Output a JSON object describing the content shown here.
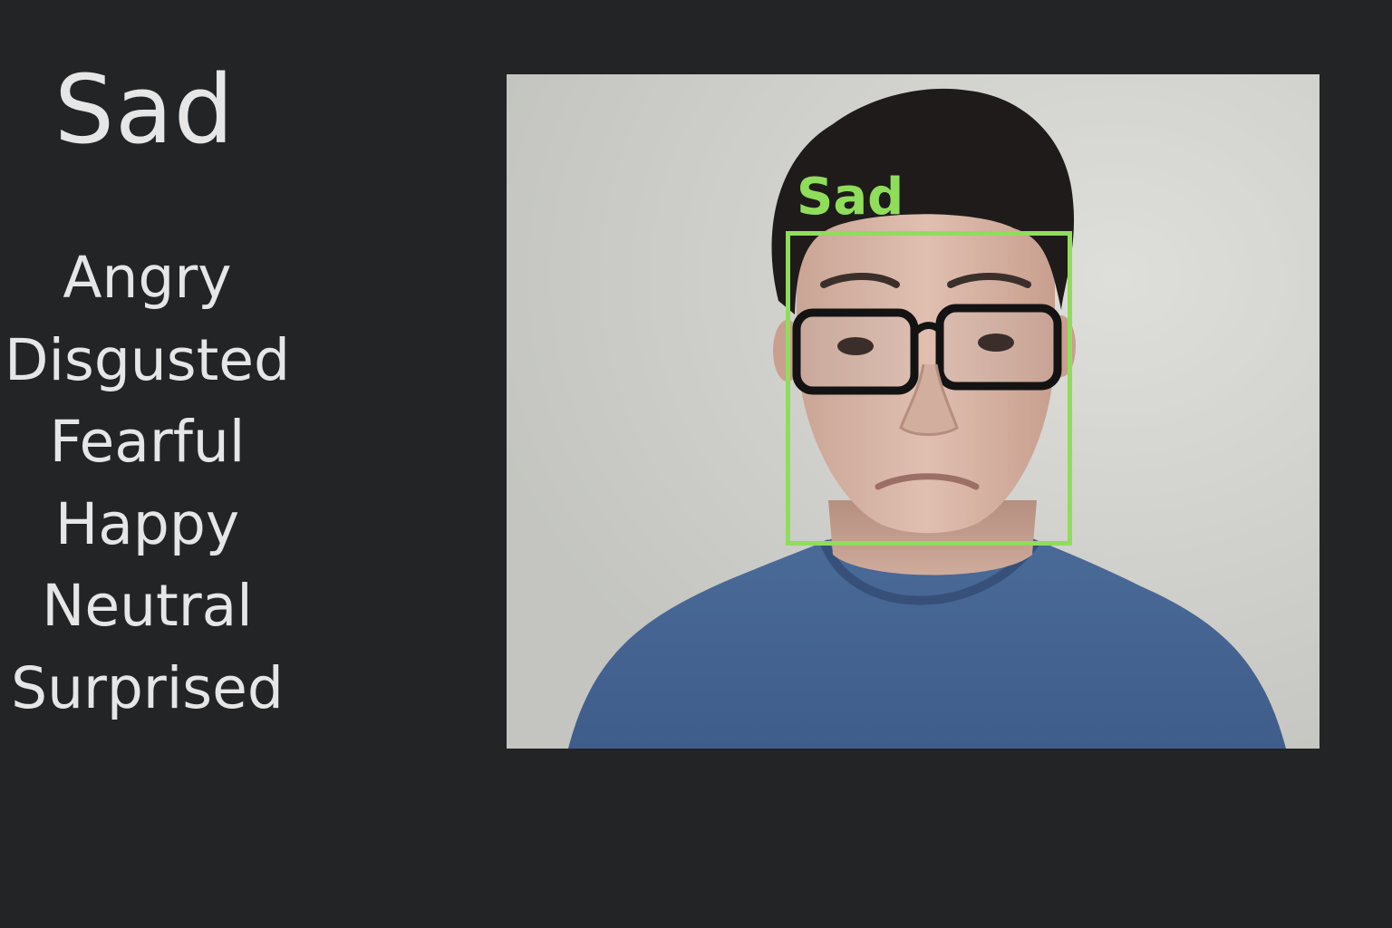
{
  "current_emotion": "Sad",
  "emotions": [
    "Angry",
    "Disgusted",
    "Fearful",
    "Happy",
    "Neutral",
    "Surprised"
  ],
  "detection": {
    "label": "Sad",
    "color": "#8fdd5b"
  },
  "colors": {
    "background": "#232426",
    "text": "#e6e6e6",
    "accent": "#8fdd5b"
  }
}
